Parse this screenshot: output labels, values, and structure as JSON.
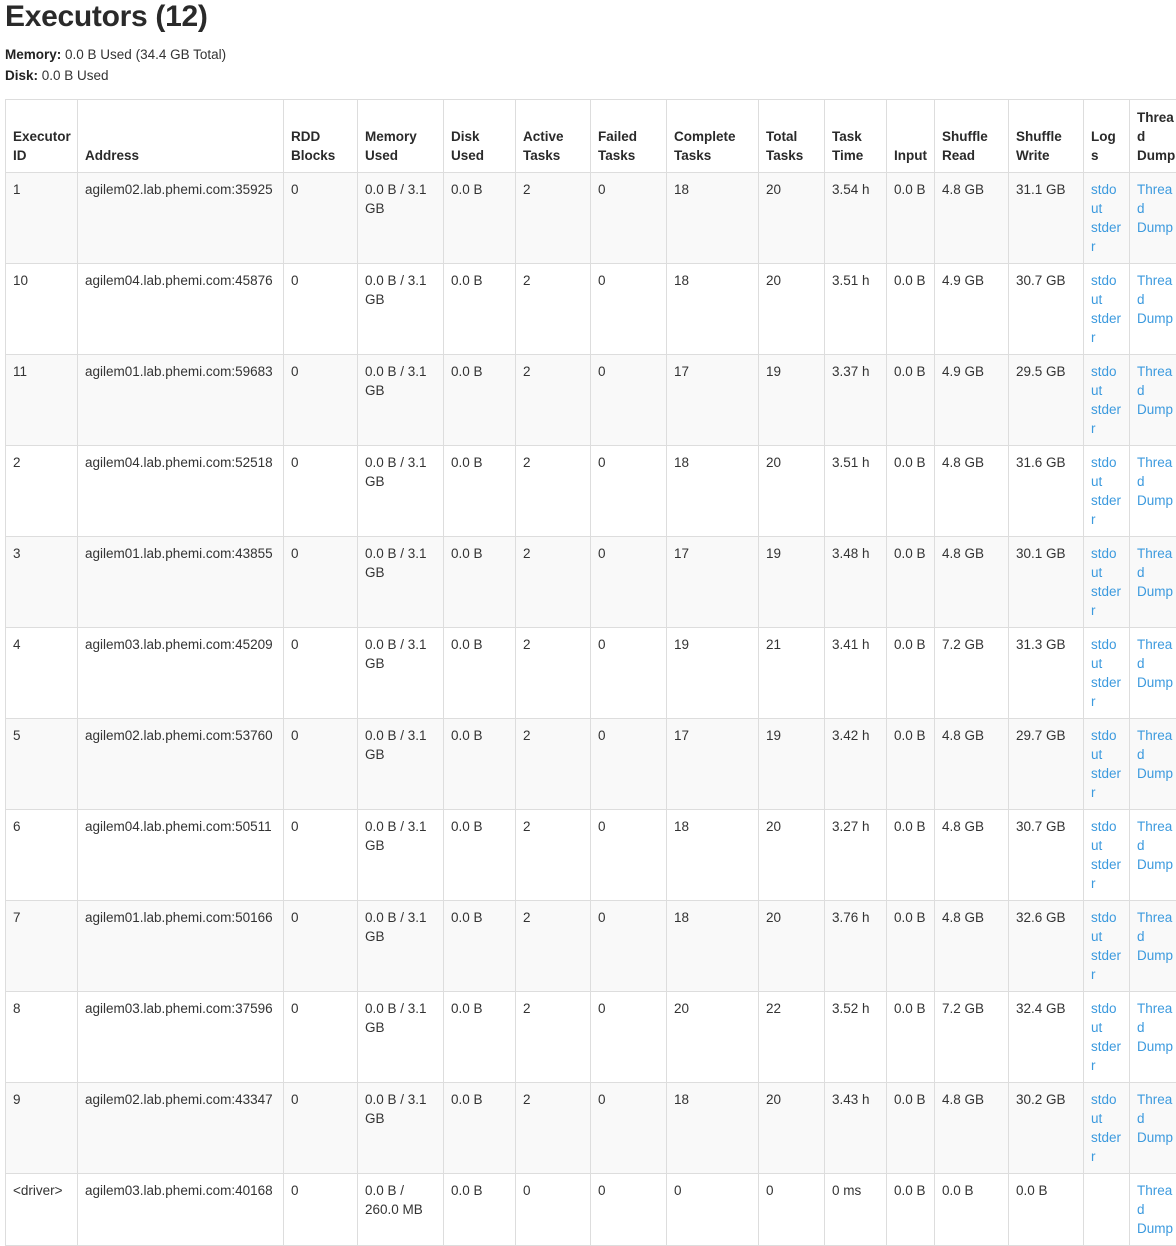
{
  "header": {
    "title": "Executors (12)",
    "memory_label": "Memory:",
    "memory_value": "0.0 B Used (34.4 GB Total)",
    "disk_label": "Disk:",
    "disk_value": "0.0 B Used"
  },
  "table": {
    "columns": [
      "Executor ID",
      "Address",
      "RDD Blocks",
      "Memory Used",
      "Disk Used",
      "Active Tasks",
      "Failed Tasks",
      "Complete Tasks",
      "Total Tasks",
      "Task Time",
      "Input",
      "Shuffle Read",
      "Shuffle Write",
      "Logs",
      "Thread Dump"
    ],
    "link_labels": {
      "stdout": "stdout",
      "stderr": "stderr",
      "thread_dump": "Thread Dump"
    },
    "rows": [
      {
        "executor_id": "1",
        "address": "agilem02.lab.phemi.com:35925",
        "rdd_blocks": "0",
        "memory_used": "0.0 B / 3.1 GB",
        "disk_used": "0.0 B",
        "active_tasks": "2",
        "failed_tasks": "0",
        "complete_tasks": "18",
        "total_tasks": "20",
        "task_time": "3.54 h",
        "input": "0.0 B",
        "shuffle_read": "4.8 GB",
        "shuffle_write": "31.1 GB",
        "has_logs": true
      },
      {
        "executor_id": "10",
        "address": "agilem04.lab.phemi.com:45876",
        "rdd_blocks": "0",
        "memory_used": "0.0 B / 3.1 GB",
        "disk_used": "0.0 B",
        "active_tasks": "2",
        "failed_tasks": "0",
        "complete_tasks": "18",
        "total_tasks": "20",
        "task_time": "3.51 h",
        "input": "0.0 B",
        "shuffle_read": "4.9 GB",
        "shuffle_write": "30.7 GB",
        "has_logs": true
      },
      {
        "executor_id": "11",
        "address": "agilem01.lab.phemi.com:59683",
        "rdd_blocks": "0",
        "memory_used": "0.0 B / 3.1 GB",
        "disk_used": "0.0 B",
        "active_tasks": "2",
        "failed_tasks": "0",
        "complete_tasks": "17",
        "total_tasks": "19",
        "task_time": "3.37 h",
        "input": "0.0 B",
        "shuffle_read": "4.9 GB",
        "shuffle_write": "29.5 GB",
        "has_logs": true
      },
      {
        "executor_id": "2",
        "address": "agilem04.lab.phemi.com:52518",
        "rdd_blocks": "0",
        "memory_used": "0.0 B / 3.1 GB",
        "disk_used": "0.0 B",
        "active_tasks": "2",
        "failed_tasks": "0",
        "complete_tasks": "18",
        "total_tasks": "20",
        "task_time": "3.51 h",
        "input": "0.0 B",
        "shuffle_read": "4.8 GB",
        "shuffle_write": "31.6 GB",
        "has_logs": true
      },
      {
        "executor_id": "3",
        "address": "agilem01.lab.phemi.com:43855",
        "rdd_blocks": "0",
        "memory_used": "0.0 B / 3.1 GB",
        "disk_used": "0.0 B",
        "active_tasks": "2",
        "failed_tasks": "0",
        "complete_tasks": "17",
        "total_tasks": "19",
        "task_time": "3.48 h",
        "input": "0.0 B",
        "shuffle_read": "4.8 GB",
        "shuffle_write": "30.1 GB",
        "has_logs": true
      },
      {
        "executor_id": "4",
        "address": "agilem03.lab.phemi.com:45209",
        "rdd_blocks": "0",
        "memory_used": "0.0 B / 3.1 GB",
        "disk_used": "0.0 B",
        "active_tasks": "2",
        "failed_tasks": "0",
        "complete_tasks": "19",
        "total_tasks": "21",
        "task_time": "3.41 h",
        "input": "0.0 B",
        "shuffle_read": "7.2 GB",
        "shuffle_write": "31.3 GB",
        "has_logs": true
      },
      {
        "executor_id": "5",
        "address": "agilem02.lab.phemi.com:53760",
        "rdd_blocks": "0",
        "memory_used": "0.0 B / 3.1 GB",
        "disk_used": "0.0 B",
        "active_tasks": "2",
        "failed_tasks": "0",
        "complete_tasks": "17",
        "total_tasks": "19",
        "task_time": "3.42 h",
        "input": "0.0 B",
        "shuffle_read": "4.8 GB",
        "shuffle_write": "29.7 GB",
        "has_logs": true
      },
      {
        "executor_id": "6",
        "address": "agilem04.lab.phemi.com:50511",
        "rdd_blocks": "0",
        "memory_used": "0.0 B / 3.1 GB",
        "disk_used": "0.0 B",
        "active_tasks": "2",
        "failed_tasks": "0",
        "complete_tasks": "18",
        "total_tasks": "20",
        "task_time": "3.27 h",
        "input": "0.0 B",
        "shuffle_read": "4.8 GB",
        "shuffle_write": "30.7 GB",
        "has_logs": true
      },
      {
        "executor_id": "7",
        "address": "agilem01.lab.phemi.com:50166",
        "rdd_blocks": "0",
        "memory_used": "0.0 B / 3.1 GB",
        "disk_used": "0.0 B",
        "active_tasks": "2",
        "failed_tasks": "0",
        "complete_tasks": "18",
        "total_tasks": "20",
        "task_time": "3.76 h",
        "input": "0.0 B",
        "shuffle_read": "4.8 GB",
        "shuffle_write": "32.6 GB",
        "has_logs": true
      },
      {
        "executor_id": "8",
        "address": "agilem03.lab.phemi.com:37596",
        "rdd_blocks": "0",
        "memory_used": "0.0 B / 3.1 GB",
        "disk_used": "0.0 B",
        "active_tasks": "2",
        "failed_tasks": "0",
        "complete_tasks": "20",
        "total_tasks": "22",
        "task_time": "3.52 h",
        "input": "0.0 B",
        "shuffle_read": "7.2 GB",
        "shuffle_write": "32.4 GB",
        "has_logs": true
      },
      {
        "executor_id": "9",
        "address": "agilem02.lab.phemi.com:43347",
        "rdd_blocks": "0",
        "memory_used": "0.0 B / 3.1 GB",
        "disk_used": "0.0 B",
        "active_tasks": "2",
        "failed_tasks": "0",
        "complete_tasks": "18",
        "total_tasks": "20",
        "task_time": "3.43 h",
        "input": "0.0 B",
        "shuffle_read": "4.8 GB",
        "shuffle_write": "30.2 GB",
        "has_logs": true
      },
      {
        "executor_id": "<driver>",
        "address": "agilem03.lab.phemi.com:40168",
        "rdd_blocks": "0",
        "memory_used": "0.0 B / 260.0 MB",
        "disk_used": "0.0 B",
        "active_tasks": "0",
        "failed_tasks": "0",
        "complete_tasks": "0",
        "total_tasks": "0",
        "task_time": "0 ms",
        "input": "0.0 B",
        "shuffle_read": "0.0 B",
        "shuffle_write": "0.0 B",
        "has_logs": false
      }
    ]
  },
  "colors": {
    "link": "#3c9ade",
    "border": "#dddddd",
    "stripe": "#f9f9f9",
    "text": "#333333"
  }
}
